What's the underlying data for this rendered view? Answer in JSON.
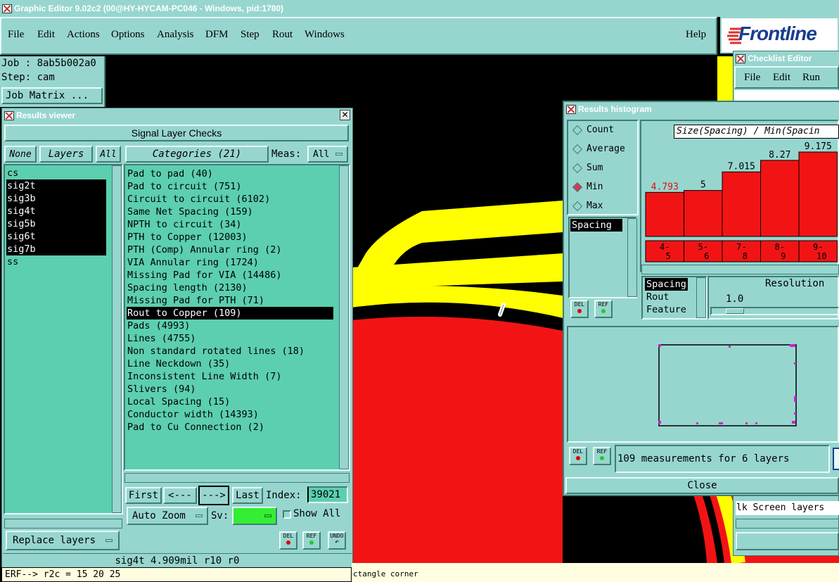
{
  "main_window": {
    "title": "Graphic Editor 9.02c2 (00@HY-HYCAM-PC046 - Windows, pid:1780)",
    "menu": [
      "File",
      "Edit",
      "Actions",
      "Options",
      "Analysis",
      "DFM",
      "Step",
      "Rout",
      "Windows"
    ],
    "help": "Help",
    "brand": "Frontline"
  },
  "job_panel": {
    "job": "Job : 8ab5b002a0",
    "step": "Step: cam",
    "job_matrix": "Job Matrix ..."
  },
  "results_viewer": {
    "title": "Results viewer",
    "header": "Signal Layer Checks",
    "none_btn": "None",
    "layers_btn": "Layers",
    "all_btn": "All",
    "categories_btn": "Categories (21)",
    "meas_label": "Meas:",
    "meas_value": "All",
    "layers": [
      "cs",
      "sig2t",
      "sig3b",
      "sig4t",
      "sig5b",
      "sig6t",
      "sig7b",
      "ss"
    ],
    "categories": [
      "Pad to pad (40)",
      "Pad to circuit (751)",
      "Circuit to circuit (6102)",
      "Same Net Spacing (159)",
      "NPTH to circuit (34)",
      "PTH to Copper (12003)",
      "PTH (Comp) Annular ring (2)",
      "VIA Annular ring (1724)",
      "Missing Pad for VIA (14486)",
      "Spacing length (2130)",
      "Missing Pad for PTH (71)",
      "Rout to Copper (109)",
      "Pads (4993)",
      "Lines (4755)",
      "Non standard rotated lines (18)",
      "Line Neckdown (35)",
      "Inconsistent Line Width (7)",
      "Slivers (94)",
      "Local Spacing (15)",
      "Conductor width (14393)",
      "Pad to Cu Connection (2)"
    ],
    "first_btn": "First",
    "prev_btn": "<---",
    "next_btn": "--->",
    "last_btn": "Last",
    "index_label": "Index:",
    "index_value": "39021",
    "auto_zoom": "Auto Zoom",
    "sv_label": "Sv:",
    "show_all": "Show All",
    "replace_layers": "Replace layers",
    "del": "DEL",
    "ref": "REF",
    "undo": "UNDO",
    "status": "sig4t 4.909mil   r10   r0"
  },
  "command_line": {
    "text": "ERF--> r2c = 15 20 25",
    "hint": "ctangle corner"
  },
  "checklist_editor": {
    "title": "Checklist Editor",
    "menu": [
      "File",
      "Edit",
      "Run"
    ],
    "screen_layers": "lk Screen layers"
  },
  "histogram": {
    "title": "Results histogram",
    "modes": [
      "Count",
      "Average",
      "Sum",
      "Min",
      "Max"
    ],
    "selected_mode": "Min",
    "list_item": "Spacing",
    "chart_title": "Size(Spacing) / Min(Spacin",
    "options": [
      "Spacing",
      "Rout",
      "Feature"
    ],
    "resolution_label": "Resolution",
    "resolution_value": "1.0",
    "measurements": "109 measurements for 6 layers",
    "close": "Close",
    "del": "DEL",
    "ref": "REF"
  },
  "chart_data": {
    "type": "bar",
    "title": "Size(Spacing) / Min(Spacin",
    "categories": [
      "4-5",
      "5-6",
      "7-8",
      "8-9",
      "9-10"
    ],
    "values": [
      4.793,
      5,
      7.015,
      8.27,
      9.175
    ],
    "value_labels": [
      "4.793",
      "5",
      "7.015",
      "8.27",
      "9.175"
    ],
    "highlight_index": 0
  },
  "colors": {
    "panel": "#97d6cf",
    "list_bg": "#5ccfb0",
    "board_red": "#f21414",
    "board_yellow": "#ffff00",
    "sv_green": "#33ee33"
  }
}
